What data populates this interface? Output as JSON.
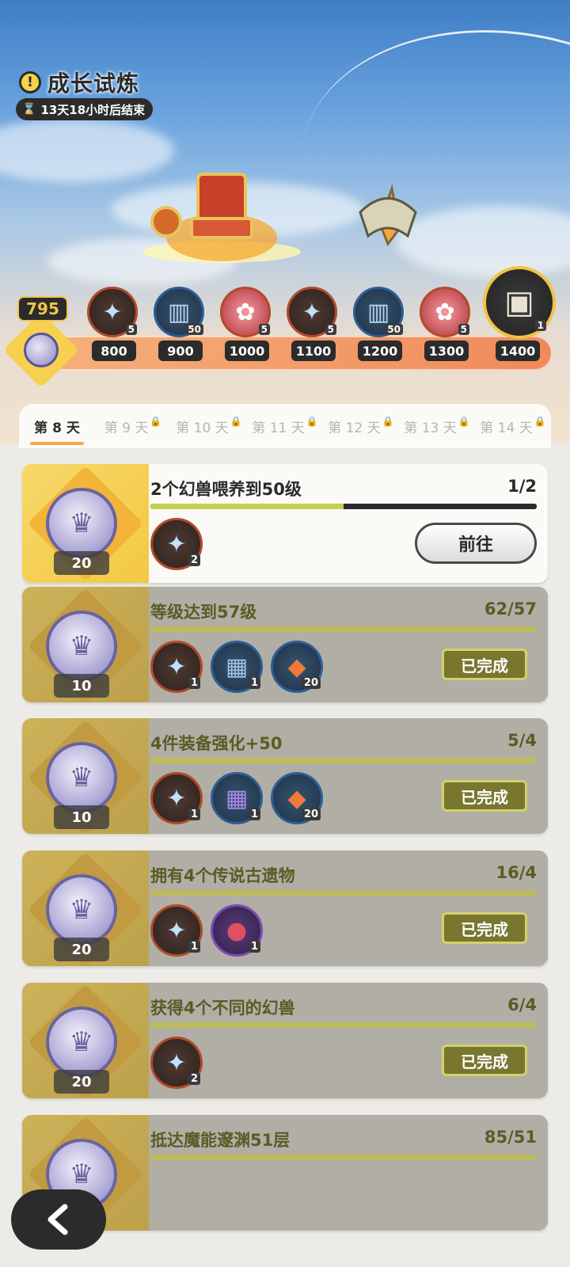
{
  "header": {
    "title": "成长试炼",
    "timer": "13天18小时后结束"
  },
  "track": {
    "points": "795",
    "milestones": [
      {
        "label": "800",
        "icon": "crystal-star-icon",
        "count": "5"
      },
      {
        "label": "900",
        "icon": "scroll-icon",
        "count": "50"
      },
      {
        "label": "1000",
        "icon": "paw-icon",
        "count": "5"
      },
      {
        "label": "1100",
        "icon": "crystal-star-icon",
        "count": "5"
      },
      {
        "label": "1200",
        "icon": "scroll-icon",
        "count": "50"
      },
      {
        "label": "1300",
        "icon": "paw-icon",
        "count": "5"
      },
      {
        "label": "1400",
        "icon": "chest-icon",
        "count": "1"
      }
    ]
  },
  "tabs": [
    {
      "label": "第 8 天",
      "locked": false
    },
    {
      "label": "第 9 天",
      "locked": true
    },
    {
      "label": "第 10 天",
      "locked": true
    },
    {
      "label": "第 11 天",
      "locked": true
    },
    {
      "label": "第 12 天",
      "locked": true
    },
    {
      "label": "第 13 天",
      "locked": true
    },
    {
      "label": "第 14 天",
      "locked": true
    }
  ],
  "tasks": [
    {
      "title": "2个幻兽喂养到50级",
      "progress": "1/2",
      "coin": "20",
      "fill": 0.5,
      "done": false,
      "action": "前往",
      "rewards": [
        {
          "icon": "crystal-star-icon",
          "count": "2",
          "color": "red"
        }
      ]
    },
    {
      "title": "等级达到57级",
      "progress": "62/57",
      "coin": "10",
      "fill": 1,
      "done": true,
      "action": "已完成",
      "rewards": [
        {
          "icon": "crystal-star-icon",
          "count": "1",
          "color": "red"
        },
        {
          "icon": "ore-crate-icon",
          "count": "1",
          "color": "blue"
        },
        {
          "icon": "fire-crystal-icon",
          "count": "20",
          "color": "blue"
        }
      ]
    },
    {
      "title": "4件装备强化+50",
      "progress": "5/4",
      "coin": "10",
      "fill": 1,
      "done": true,
      "action": "已完成",
      "rewards": [
        {
          "icon": "crystal-star-icon",
          "count": "1",
          "color": "red"
        },
        {
          "icon": "gem-crate-icon",
          "count": "1",
          "color": "blue"
        },
        {
          "icon": "fire-crystal-icon",
          "count": "20",
          "color": "blue"
        }
      ]
    },
    {
      "title": "拥有4个传说古遗物",
      "progress": "16/4",
      "coin": "20",
      "fill": 1,
      "done": true,
      "action": "已完成",
      "rewards": [
        {
          "icon": "crystal-star-icon",
          "count": "1",
          "color": "red"
        },
        {
          "icon": "apple-icon",
          "count": "1",
          "color": "purple"
        }
      ]
    },
    {
      "title": "获得4个不同的幻兽",
      "progress": "6/4",
      "coin": "20",
      "fill": 1,
      "done": true,
      "action": "已完成",
      "rewards": [
        {
          "icon": "crystal-star-icon",
          "count": "2",
          "color": "red"
        }
      ]
    },
    {
      "title": "抵达魔能邃渊51层",
      "progress": "85/51",
      "coin": "",
      "fill": 1,
      "done": true,
      "action": "",
      "rewards": []
    }
  ],
  "colors": {
    "accent": "#f5a84a",
    "done_badge": "#78762f",
    "track": "#f08a5a"
  }
}
